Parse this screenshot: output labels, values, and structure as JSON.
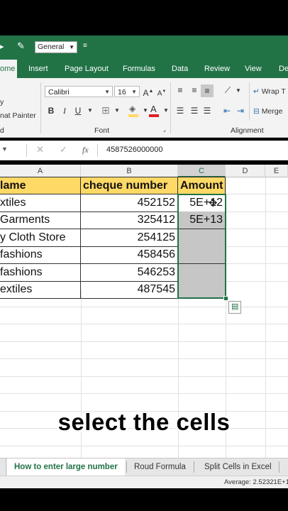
{
  "quick_access": {
    "number_format": "General"
  },
  "tabs": [
    "ome",
    "Insert",
    "Page Layout",
    "Formulas",
    "Data",
    "Review",
    "View",
    "Dev"
  ],
  "ribbon": {
    "clipboard": {
      "copy": "y",
      "format_painter": "nat Painter",
      "label": "d"
    },
    "font": {
      "name": "Calibri",
      "size": "16",
      "label": "Font",
      "bold": "B",
      "italic": "I",
      "underline": "U"
    },
    "alignment": {
      "wrap": "Wrap T",
      "merge": "Merge",
      "label": "Alignment"
    }
  },
  "formula_bar": {
    "value": "4587526000000",
    "fx": "fx"
  },
  "columns": [
    "A",
    "B",
    "C",
    "D",
    "E"
  ],
  "table": {
    "headers": [
      "lame",
      "cheque number",
      "Amount"
    ],
    "rows": [
      {
        "name": "xtiles",
        "cheque": "452152",
        "amount": "5E+12"
      },
      {
        "name": "Garments",
        "cheque": "325412",
        "amount": "5E+13"
      },
      {
        "name": "y Cloth Store",
        "cheque": "254125",
        "amount": ""
      },
      {
        "name": "fashions",
        "cheque": "458456",
        "amount": ""
      },
      {
        "name": "fashions",
        "cheque": "546253",
        "amount": ""
      },
      {
        "name": "extiles",
        "cheque": "487545",
        "amount": ""
      }
    ]
  },
  "caption": "select the cells",
  "sheet_tabs": [
    "How to enter large number",
    "Roud Formula",
    "Split Cells in Excel"
  ],
  "status": {
    "average": "Average: 2.52321E+1"
  },
  "colors": {
    "excel_green": "#217346",
    "header_fill": "#ffd966",
    "selection": "#c6c6c6"
  }
}
